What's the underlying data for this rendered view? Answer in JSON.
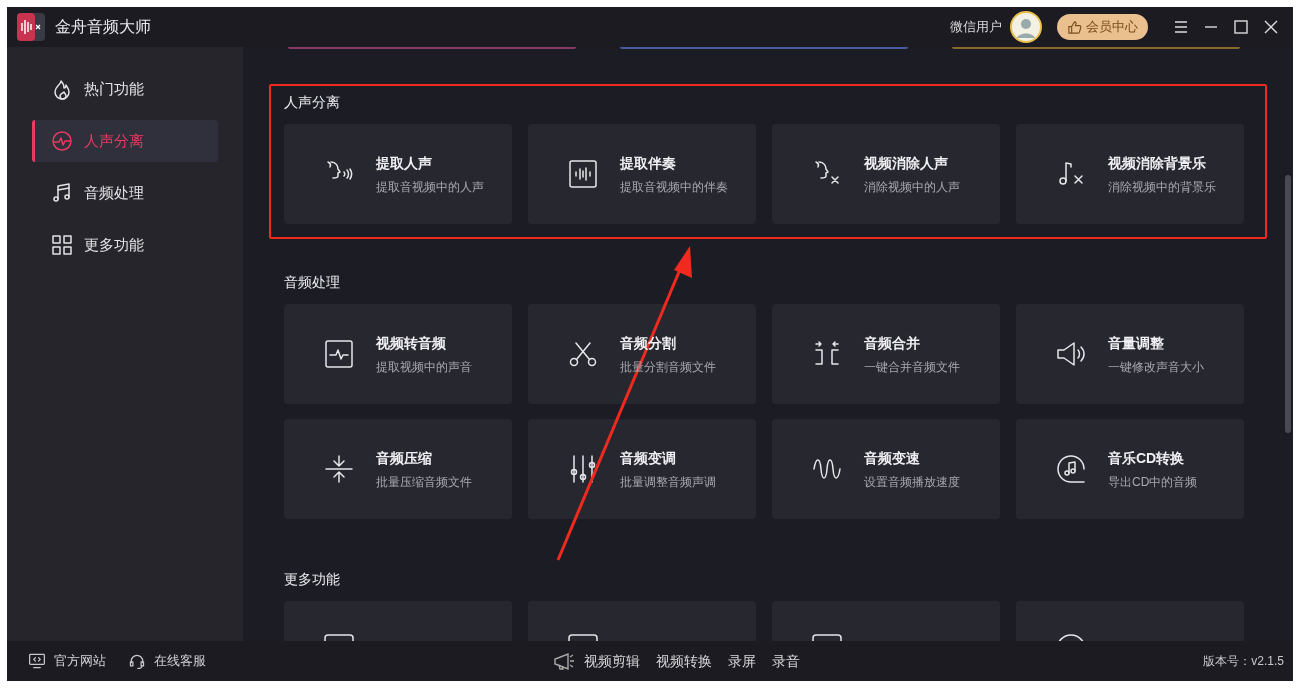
{
  "window": {
    "title": "金舟音频大师"
  },
  "user": {
    "name": "微信用户",
    "vip_button": "会员中心"
  },
  "sidebar": {
    "items": [
      {
        "label": "热门功能",
        "selected": false
      },
      {
        "label": "人声分离",
        "selected": true
      },
      {
        "label": "音频处理",
        "selected": false
      },
      {
        "label": "更多功能",
        "selected": false
      }
    ]
  },
  "sections": [
    {
      "title": "人声分离",
      "highlighted": true,
      "cards": [
        {
          "title": "提取人声",
          "subtitle": "提取音视频中的人声"
        },
        {
          "title": "提取伴奏",
          "subtitle": "提取音视频中的伴奏"
        },
        {
          "title": "视频消除人声",
          "subtitle": "消除视频中的人声"
        },
        {
          "title": "视频消除背景乐",
          "subtitle": "消除视频中的背景乐"
        }
      ]
    },
    {
      "title": "音频处理",
      "highlighted": false,
      "cards": [
        {
          "title": "视频转音频",
          "subtitle": "提取视频中的声音"
        },
        {
          "title": "音频分割",
          "subtitle": "批量分割音频文件"
        },
        {
          "title": "音频合并",
          "subtitle": "一键合并音频文件"
        },
        {
          "title": "音量调整",
          "subtitle": "一键修改声音大小"
        },
        {
          "title": "音频压缩",
          "subtitle": "批量压缩音频文件"
        },
        {
          "title": "音频变调",
          "subtitle": "批量调整音频声调"
        },
        {
          "title": "音频变速",
          "subtitle": "设置音频播放速度"
        },
        {
          "title": "音乐CD转换",
          "subtitle": "导出CD中的音频"
        }
      ]
    },
    {
      "title": "更多功能",
      "highlighted": false
    }
  ],
  "footer": {
    "left_links": [
      "官方网站",
      "在线客服"
    ],
    "center_links": [
      "视频剪辑",
      "视频转换",
      "录屏",
      "录音"
    ],
    "version": "版本号：v2.1.5"
  }
}
